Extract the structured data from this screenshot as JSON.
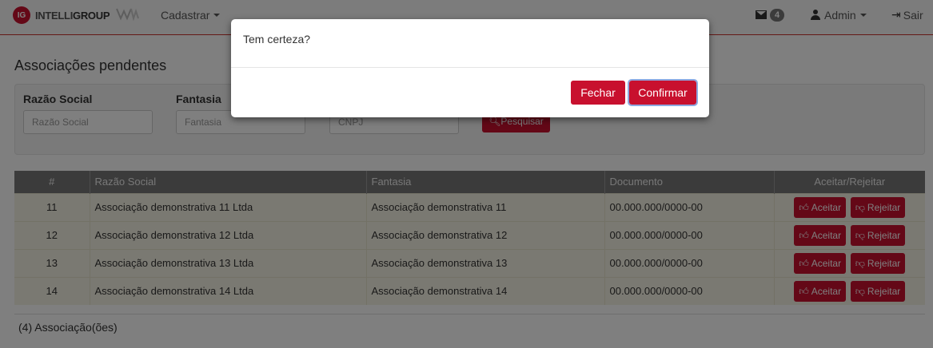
{
  "header": {
    "brand_badge": "IG",
    "brand_part1": "INTELLI",
    "brand_part2": "GROUP",
    "menu_cadastrar": "Cadastrar",
    "mail_count": "4",
    "user_name": "Admin",
    "logout_label": "Sair"
  },
  "page": {
    "title": "Associações pendentes"
  },
  "filters": {
    "razao_label": "Razão Social",
    "razao_placeholder": "Razão Social",
    "fantasia_label": "Fantasia",
    "fantasia_placeholder": "Fantasia",
    "cnpj_placeholder": "CNPJ",
    "search_label": "Pesquisar"
  },
  "table": {
    "columns": [
      "#",
      "Razão Social",
      "Fantasia",
      "Documento",
      "Aceitar/Rejeitar"
    ],
    "accept_label": "Aceitar",
    "reject_label": "Rejeitar",
    "rows": [
      {
        "num": "11",
        "razao": "Associação demonstrativa 11 Ltda",
        "fantasia": "Associação demonstrativa 11",
        "documento": "00.000.000/0000-00"
      },
      {
        "num": "12",
        "razao": "Associação demonstrativa 12 Ltda",
        "fantasia": "Associação demonstrativa 12",
        "documento": "00.000.000/0000-00"
      },
      {
        "num": "13",
        "razao": "Associação demonstrativa 13 Ltda",
        "fantasia": "Associação demonstrativa 13",
        "documento": "00.000.000/0000-00"
      },
      {
        "num": "14",
        "razao": "Associação demonstrativa 14 Ltda",
        "fantasia": "Associação demonstrativa 14",
        "documento": "00.000.000/0000-00"
      }
    ]
  },
  "footer": {
    "count_text": "(4) Associação(ões)"
  },
  "modal": {
    "message": "Tem certeza?",
    "close_label": "Fechar",
    "confirm_label": "Confirmar"
  },
  "colors": {
    "accent": "#c8102e",
    "table_header": "#777777",
    "row_bg": "#f5f2e4"
  }
}
